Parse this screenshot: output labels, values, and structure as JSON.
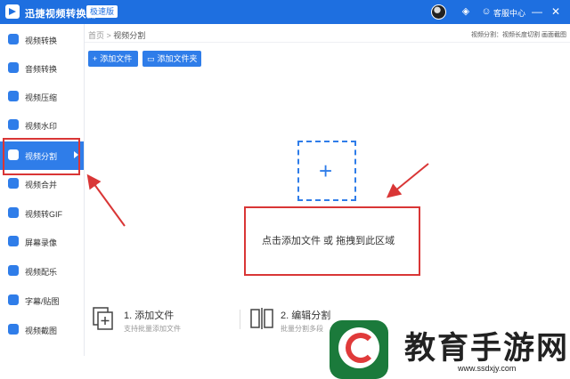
{
  "titlebar": {
    "app_title": "迅捷视频转换器",
    "edition_badge": "极速版",
    "help_label": "客服中心",
    "minimize": "—",
    "close": "✕"
  },
  "sidebar": {
    "items": [
      {
        "label": "视频转换",
        "icon": "video-convert-icon"
      },
      {
        "label": "音频转换",
        "icon": "audio-convert-icon"
      },
      {
        "label": "视频压缩",
        "icon": "video-compress-icon"
      },
      {
        "label": "视频水印",
        "icon": "watermark-icon"
      },
      {
        "label": "视频分割",
        "icon": "split-icon",
        "active": true
      },
      {
        "label": "视频合并",
        "icon": "merge-icon"
      },
      {
        "label": "视频转GIF",
        "icon": "gif-icon"
      },
      {
        "label": "屏幕录像",
        "icon": "record-icon"
      },
      {
        "label": "视频配乐",
        "icon": "music-icon"
      },
      {
        "label": "字幕/贴图",
        "icon": "subtitle-icon"
      },
      {
        "label": "视频截图",
        "icon": "screenshot-icon"
      }
    ]
  },
  "breadcrumb": {
    "home": "首页",
    "sep": " > ",
    "current": "视频分割"
  },
  "top_hint": "视频分割：视频长度切割 画面截图",
  "toolbar": {
    "add_file": "添加文件",
    "add_folder": "添加文件夹"
  },
  "dropzone": {
    "plus": "+",
    "text": "点击添加文件 或 拖拽到此区域"
  },
  "steps": [
    {
      "title": "1. 添加文件",
      "desc": "支持批量添加文件"
    },
    {
      "title": "2. 编辑分割",
      "desc": "批量分割多段"
    }
  ],
  "watermark": {
    "text": "教育手游网",
    "url": "www.ssdxjy.com"
  },
  "colors": {
    "brand": "#1e6fe0",
    "accent": "#2f7de9",
    "annotation_red": "#d93636"
  }
}
